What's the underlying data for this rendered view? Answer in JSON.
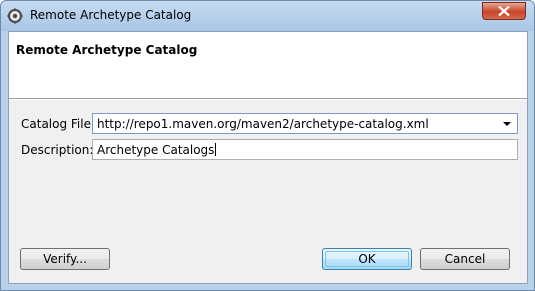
{
  "window": {
    "title": "Remote Archetype Catalog"
  },
  "header": {
    "title": "Remote Archetype Catalog"
  },
  "form": {
    "catalog_file_label": "Catalog File:",
    "catalog_file_value": "http://repo1.maven.org/maven2/archetype-catalog.xml",
    "description_label": "Description:",
    "description_value": "Archetype Catalogs"
  },
  "buttons": {
    "verify": "Verify...",
    "ok": "OK",
    "cancel": "Cancel"
  },
  "icons": {
    "app": "gear-icon",
    "close": "close-icon",
    "dropdown": "chevron-down-icon"
  },
  "colors": {
    "titlebar": "#b9d1ea",
    "close_button": "#c6452a",
    "dialog_bg": "#f0f0f0"
  }
}
